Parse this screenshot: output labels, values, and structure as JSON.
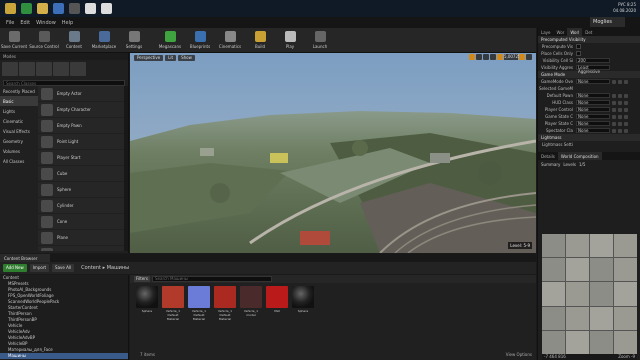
{
  "taskbar": {
    "time": "8:25",
    "date": "04.08.2020",
    "lang": "РУС",
    "pinned": [
      "file-explorer-icon",
      "chrome-icon",
      "folder-icon",
      "app-icon",
      "app-icon",
      "unreal-icon",
      "unreal-icon"
    ]
  },
  "menu": {
    "items": [
      "File",
      "Edit",
      "Window",
      "Help"
    ],
    "level_tab": "Moglies"
  },
  "toolbar": {
    "buttons": [
      {
        "label": "Save Current",
        "color": "#6b6b6b"
      },
      {
        "label": "Source Control",
        "color": "#5a5a5a"
      },
      {
        "label": "Content",
        "color": "#6a7a8a"
      },
      {
        "label": "Marketplace",
        "color": "#4a6a9a"
      },
      {
        "label": "Settings",
        "color": "#777777"
      },
      {
        "label": "Megascans",
        "color": "#3fa33f"
      },
      {
        "label": "Blueprints",
        "color": "#3a6fb0"
      },
      {
        "label": "Cinematics",
        "color": "#888888"
      },
      {
        "label": "Build",
        "color": "#c8a034"
      },
      {
        "label": "Play",
        "color": "#bbbbbb"
      },
      {
        "label": "Launch",
        "color": "#666666"
      }
    ]
  },
  "modes": {
    "title": "Modes",
    "search_placeholder": "Search Classes",
    "categories": [
      "Recently Placed",
      "Basic",
      "Lights",
      "Cinematic",
      "Visual Effects",
      "Geometry",
      "Volumes",
      "All Classes"
    ],
    "active_category": 1,
    "items": [
      "Empty Actor",
      "Empty Character",
      "Empty Pawn",
      "Point Light",
      "Player Start",
      "Cube",
      "Sphere",
      "Cylinder",
      "Cone",
      "Plane",
      "Box Trigger"
    ]
  },
  "viewport": {
    "buttons": [
      "Perspective",
      "Lit",
      "Show"
    ],
    "camera_speed": "5,00725",
    "grid_value": "10",
    "level_label": "Level: 5-9"
  },
  "right_panel": {
    "tabs": [
      "Laye",
      "Wor",
      "Worl",
      "Det"
    ],
    "section1": "Precomputed Visibility",
    "rows1": [
      {
        "label": "Precompute Vis",
        "type": "check"
      },
      {
        "label": "Place Cells Only",
        "type": "check"
      },
      {
        "label": "Visibility Cell Si",
        "type": "value",
        "value": "200"
      },
      {
        "label": "Visibility Aggres",
        "type": "value",
        "value": "Least Aggressive"
      }
    ],
    "section2": "Game Mode",
    "rows2": [
      {
        "label": "GameMode Ove",
        "type": "value",
        "value": "None"
      },
      {
        "label": "Selected GameM",
        "type": "text"
      },
      {
        "label": "Default Pawn",
        "type": "value",
        "value": "None"
      },
      {
        "label": "HUD Class",
        "type": "value",
        "value": "None"
      },
      {
        "label": "Player Control",
        "type": "value",
        "value": "None"
      },
      {
        "label": "Game State C",
        "type": "value",
        "value": "None"
      },
      {
        "label": "Player State C",
        "type": "value",
        "value": "None"
      },
      {
        "label": "Spectator Cla",
        "type": "value",
        "value": "None"
      }
    ],
    "section3": "Lightmass",
    "section4": "Lightmass Setti",
    "lower_tabs": [
      "Details",
      "World Composition"
    ],
    "wc_tools": [
      "Summary",
      "Levels"
    ],
    "wc_count": "1/5",
    "wc_coords": "-7 464 816",
    "wc_zoom": "Zoom -9"
  },
  "content_browser": {
    "tab": "Content Browser",
    "add_new": "Add New",
    "import": "Import",
    "save_all": "Save All",
    "path": [
      "Content",
      "Машины"
    ],
    "filters": "Filters",
    "search_placeholder": "Search Машины",
    "tree": [
      "Content",
      "MSPresets",
      "PhotoAI_Backgrounds",
      "FPS_OpenWorldFoliage",
      "ScannedWorldPeoplePack",
      "StarterContent",
      "ThirdPerson",
      "ThirdPersonBP",
      "Vehicle",
      "VehicleAdv",
      "VehicleAdvBP",
      "VehicleBP",
      "Материалы_для_Face",
      "Машины"
    ],
    "selected_tree": 13,
    "assets": [
      {
        "name": "Sphere",
        "color": "#1a1a1a"
      },
      {
        "name": "Vehicle_1 Default Material",
        "color": "#b23a2a"
      },
      {
        "name": "Vehicle_1 Default Material",
        "color": "#6b7bd8"
      },
      {
        "name": "Vehicle_1 Default Material",
        "color": "#aa2a22"
      },
      {
        "name": "Vehicle_1 model",
        "color": "#4a2a2a"
      },
      {
        "name": "Mat",
        "color": "#bb1a1a"
      },
      {
        "name": "Sphere",
        "color": "#222222"
      }
    ],
    "count": "7 items",
    "view_options": "View Options"
  }
}
